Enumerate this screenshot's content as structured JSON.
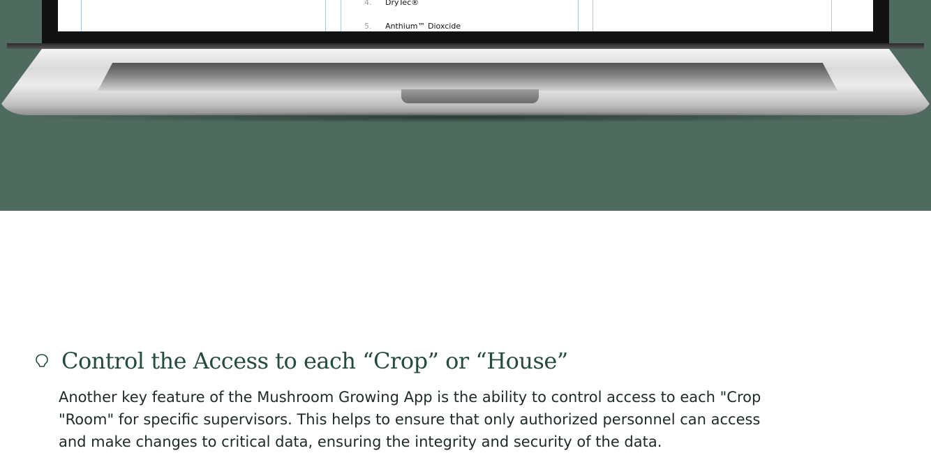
{
  "hero": {
    "background_color": "#4f6a5f",
    "screen_list": [
      {
        "number": "4.",
        "label": "DryTec®"
      },
      {
        "number": "5.",
        "label": "Anthium™ Dioxcide"
      }
    ]
  },
  "section": {
    "icon": "lightbulb-outline-icon",
    "title": "Control the Access to each “Crop” or “House”",
    "body_lines": [
      "Another key feature of the Mushroom Growing App is the ability to control access to each \"Crop",
      "\"Room\" for specific supervisors. This helps to ensure that only authorized personnel can access",
      "and make changes to critical data, ensuring the integrity and security of the data."
    ]
  }
}
